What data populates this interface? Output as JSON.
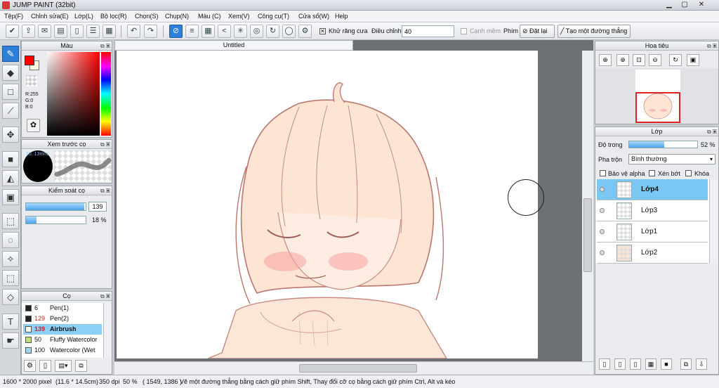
{
  "window": {
    "title": "JUMP PAINT (32bit)",
    "minimize": "▁",
    "maximize": "▢",
    "close": "✕"
  },
  "menu": [
    "Tệp(F)",
    "Chỉnh sửa(E)",
    "Lớp(L)",
    "Bộ lọc(R)",
    "Chọn(S)",
    "Chụp(N)",
    "Màu (C)",
    "Xem(V)",
    "Công cụ(T)",
    "Cửa sổ(W)",
    "Help"
  ],
  "toolbar": {
    "antialias_label": "Khử răng cưa",
    "adjust_label": "Điều chỉnh",
    "adjust_value": "40",
    "smooth_label": "Cạnh mềm",
    "key_label": "Phím",
    "reset_label": "Đặt lại",
    "straight_line_label": "Tạo một đường thẳng"
  },
  "color_panel": {
    "title": "Màu",
    "r": "R:255",
    "g": "G:0",
    "b": "B:0",
    "fg": "#ff0000",
    "bg": "#fff6dc"
  },
  "brush_preview": {
    "title": "Xem trước cọ",
    "size": "10. 13mm"
  },
  "brush_control": {
    "title": "Kiểm soát cọ",
    "size_value": "139",
    "opacity_value": "18 %",
    "size_fraction": 0.98,
    "opacity_fraction": 0.18
  },
  "brushes": {
    "title": "Cọ",
    "items": [
      {
        "size": "6",
        "name": "Pen(1)",
        "color": "#222222",
        "size_color": "#111111"
      },
      {
        "size": "129",
        "name": "Pen(2)",
        "color": "#222222",
        "size_color": "#d02020"
      },
      {
        "size": "139",
        "name": "Airbrush",
        "color": "#ffffff",
        "size_color": "#d02020"
      },
      {
        "size": "50",
        "name": "Fluffy Watercolor",
        "color": "#bfe36a",
        "size_color": "#111111"
      },
      {
        "size": "100",
        "name": "Watercolor (Wet",
        "color": "#9fd8f0",
        "size_color": "#111111"
      }
    ]
  },
  "document": {
    "tab_title": "Untitled"
  },
  "navigator": {
    "title": "Hoa tiêu"
  },
  "layers": {
    "title": "Lớp",
    "opacity_label": "Độ trong",
    "opacity_value": "52 %",
    "opacity_fraction": 0.52,
    "blend_label": "Pha trộn",
    "blend_value": "Bình thường",
    "protect_alpha": "Bảo vệ alpha",
    "clip": "Xén bớt",
    "lock": "Khóa",
    "items": [
      {
        "name": "Lớp4",
        "active": true
      },
      {
        "name": "Lớp3",
        "active": false
      },
      {
        "name": "Lớp1",
        "active": false
      },
      {
        "name": "Lớp2",
        "active": false
      }
    ]
  },
  "status": {
    "dimensions": "1600 * 2000 pixel",
    "physical": "(11.6 * 14.5cm)",
    "dpi": "350 dpi",
    "zoom": "50 %",
    "cursor": "( 1549, 1386 )",
    "hint": "Vẽ một đường thẳng bằng cách giữ phím Shift, Thay đổi cỡ cọ bằng cách giữ phím Ctrl, Alt và kéo"
  }
}
